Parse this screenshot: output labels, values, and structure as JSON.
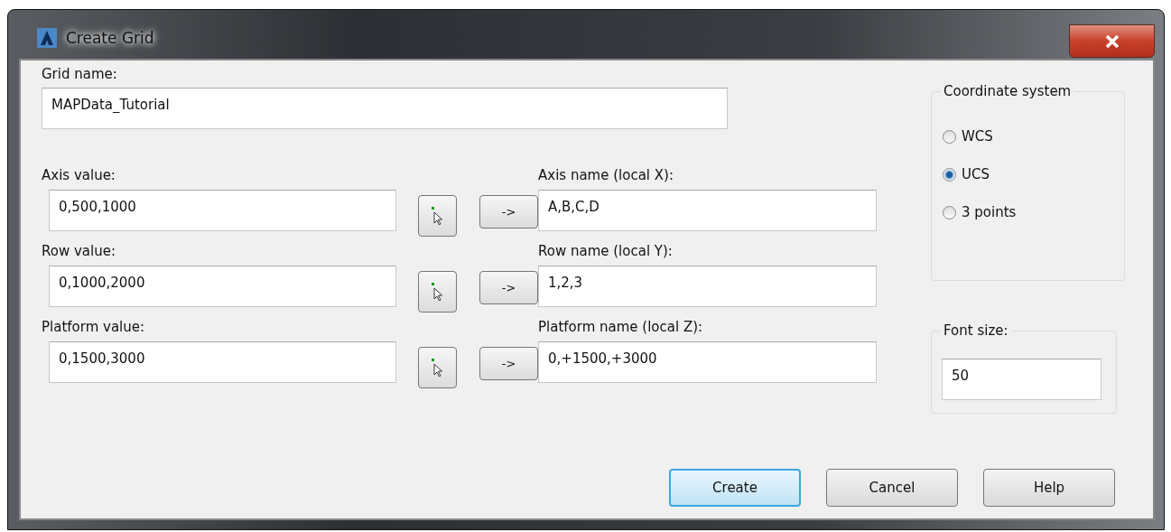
{
  "window": {
    "title": "Create Grid"
  },
  "grid_name": {
    "label": "Grid name:",
    "value": "MAPData_Tutorial"
  },
  "rows": [
    {
      "value_label": "Axis value:",
      "value": "0,500,1000",
      "arrow": "->",
      "name_label": "Axis name (local X):",
      "name_value": "A,B,C,D"
    },
    {
      "value_label": "Row value:",
      "value": "0,1000,2000",
      "arrow": "->",
      "name_label": "Row name (local Y):",
      "name_value": "1,2,3"
    },
    {
      "value_label": "Platform value:",
      "value": "0,1500,3000",
      "arrow": "->",
      "name_label": "Platform name (local Z):",
      "name_value": "0,+1500,+3000"
    }
  ],
  "coordinate_system": {
    "title": "Coordinate system",
    "options": [
      {
        "label": "WCS",
        "selected": false
      },
      {
        "label": "UCS",
        "selected": true
      },
      {
        "label": "3 points",
        "selected": false
      }
    ]
  },
  "font_size": {
    "label": "Font size:",
    "value": "50"
  },
  "buttons": [
    {
      "label": "Create",
      "default": true
    },
    {
      "label": "Cancel",
      "default": false
    },
    {
      "label": "Help",
      "default": false
    }
  ]
}
